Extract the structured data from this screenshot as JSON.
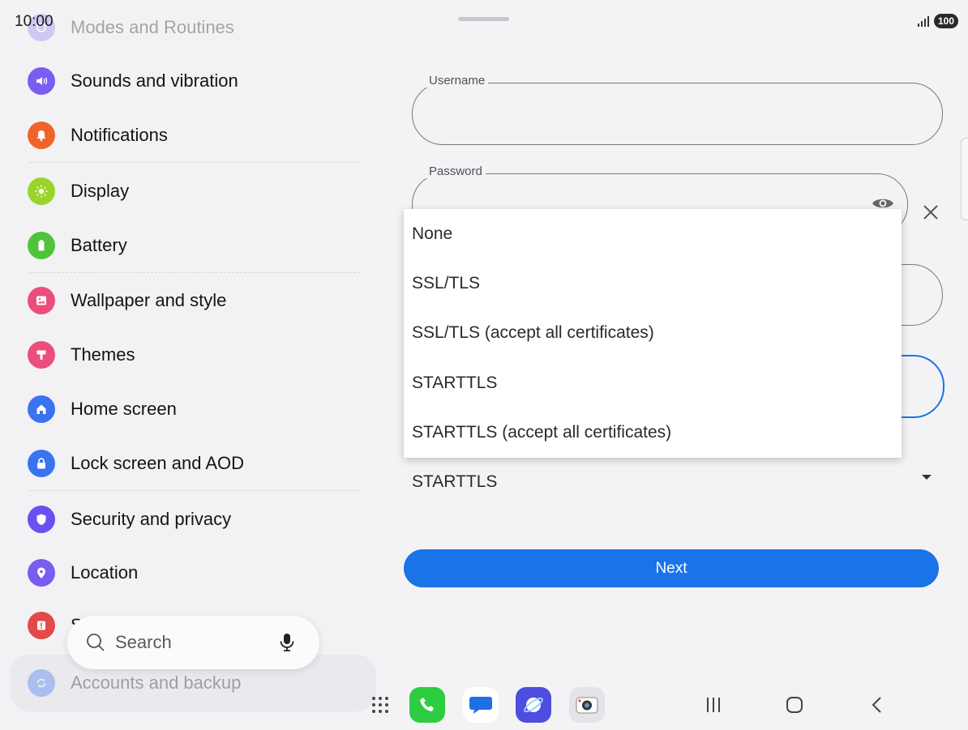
{
  "status_bar": {
    "time": "10:00",
    "battery": "100"
  },
  "settings": {
    "items": [
      {
        "label": "Modes and Routines",
        "icon": "modes-icon",
        "color": "#8b7cf6"
      },
      {
        "label": "Sounds and vibration",
        "icon": "speaker-icon",
        "color": "#7b5cf0"
      },
      {
        "label": "Notifications",
        "icon": "bell-icon",
        "color": "#f0642a"
      },
      {
        "label": "Display",
        "icon": "sun-icon",
        "color": "#9ad32a"
      },
      {
        "label": "Battery",
        "icon": "battery-icon",
        "color": "#4fc43a"
      },
      {
        "label": "Wallpaper and style",
        "icon": "image-icon",
        "color": "#ec4e7c"
      },
      {
        "label": "Themes",
        "icon": "brush-icon",
        "color": "#ec4e7c"
      },
      {
        "label": "Home screen",
        "icon": "home-icon",
        "color": "#3a73f0"
      },
      {
        "label": "Lock screen and AOD",
        "icon": "lock-icon",
        "color": "#3a73f0"
      },
      {
        "label": "Security and privacy",
        "icon": "shield-icon",
        "color": "#6b4ff2"
      },
      {
        "label": "Location",
        "icon": "location-pin-icon",
        "color": "#7b5cf0"
      },
      {
        "label": "S",
        "icon": "alert-icon",
        "color": "#e24a4a"
      },
      {
        "label": "Accounts and backup",
        "icon": "sync-icon",
        "color": "#3a73f0"
      }
    ],
    "search_placeholder": "Search"
  },
  "form": {
    "username_label": "Username",
    "password_label": "Password",
    "security_value": "STARTTLS",
    "next_label": "Next"
  },
  "dropdown": {
    "options": [
      "None",
      "SSL/TLS",
      "SSL/TLS (accept all certificates)",
      "STARTTLS",
      "STARTTLS (accept all certificates)"
    ]
  },
  "dock": {
    "apps": [
      "phone-app-icon",
      "messages-app-icon",
      "internet-app-icon",
      "camera-app-icon"
    ]
  },
  "colors": {
    "accent": "#1a73e8"
  }
}
